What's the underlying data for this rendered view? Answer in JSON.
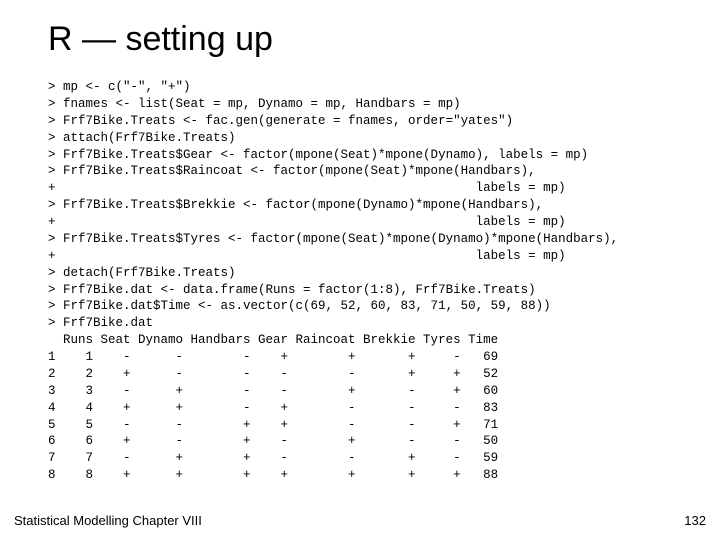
{
  "title": "R — setting up",
  "code_lines": [
    "> mp <- c(\"-\", \"+\")",
    "> fnames <- list(Seat = mp, Dynamo = mp, Handbars = mp)",
    "> Frf7Bike.Treats <- fac.gen(generate = fnames, order=\"yates\")",
    "> attach(Frf7Bike.Treats)",
    "> Frf7Bike.Treats$Gear <- factor(mpone(Seat)*mpone(Dynamo), labels = mp)",
    "> Frf7Bike.Treats$Raincoat <- factor(mpone(Seat)*mpone(Handbars),",
    "+                                                        labels = mp)",
    "> Frf7Bike.Treats$Brekkie <- factor(mpone(Dynamo)*mpone(Handbars),",
    "+                                                        labels = mp)",
    "> Frf7Bike.Treats$Tyres <- factor(mpone(Seat)*mpone(Dynamo)*mpone(Handbars),",
    "+                                                        labels = mp)",
    "> detach(Frf7Bike.Treats)",
    "> Frf7Bike.dat <- data.frame(Runs = factor(1:8), Frf7Bike.Treats)",
    "> Frf7Bike.dat$Time <- as.vector(c(69, 52, 60, 83, 71, 50, 59, 88))",
    "> Frf7Bike.dat",
    "  Runs Seat Dynamo Handbars Gear Raincoat Brekkie Tyres Time",
    "1    1    -      -        -    +        +       +     -   69",
    "2    2    +      -        -    -        -       +     +   52",
    "3    3    -      +        -    -        +       -     +   60",
    "4    4    +      +        -    +        -       -     -   83",
    "5    5    -      -        +    +        -       -     +   71",
    "6    6    +      -        +    -        +       -     -   50",
    "7    7    -      +        +    -        -       +     -   59",
    "8    8    +      +        +    +        +       +     +   88"
  ],
  "footer_left": "Statistical Modelling   Chapter VIII",
  "footer_right": "132"
}
